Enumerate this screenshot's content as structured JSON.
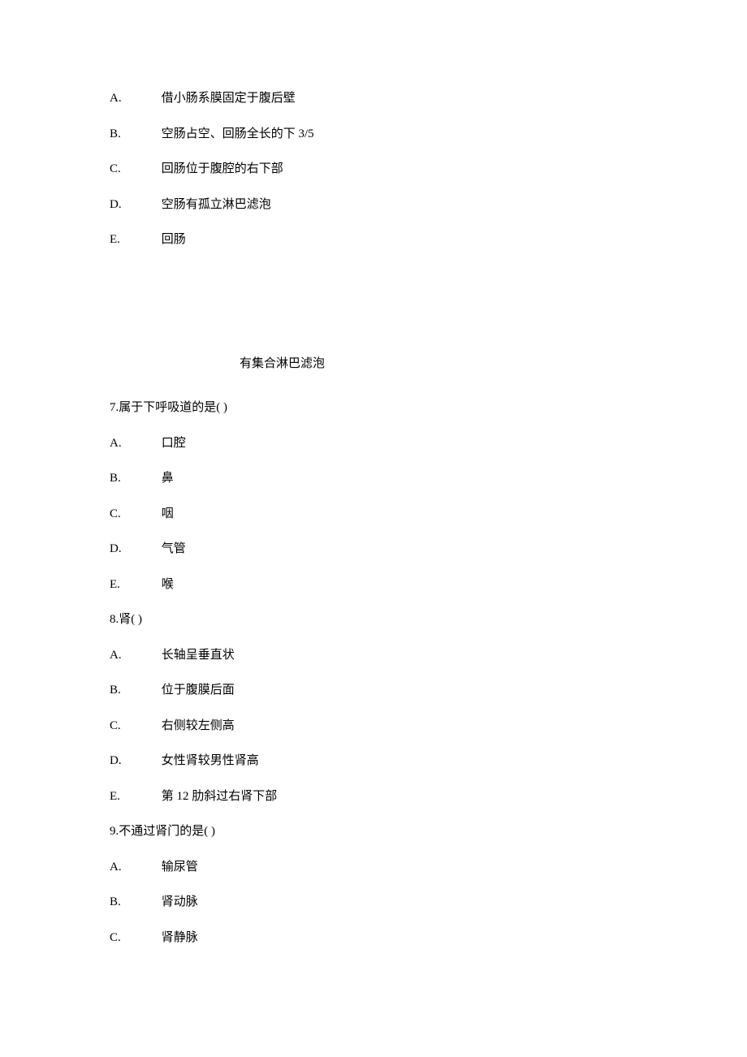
{
  "q6": {
    "A": "借小肠系膜固定于腹后壁",
    "B": "空肠占空、回肠全长的下 3/5",
    "C": "回肠位于腹腔的右下部",
    "D": "空肠有孤立淋巴滤泡",
    "E": " 回肠"
  },
  "fragment": "有集合淋巴滤泡",
  "q7": {
    "stem": "7.属于下呼吸道的是(   )",
    "A": "口腔",
    "B": "鼻",
    "C": "咽",
    "D": "气管",
    "E": " 喉"
  },
  "q8": {
    "stem": "8.肾(  )",
    "A": "长轴呈垂直状",
    "B": "位于腹膜后面",
    "C": "右侧较左侧高",
    "D": "女性肾较男性肾高",
    "E": "  第 12 肋斜过右肾下部"
  },
  "q9": {
    "stem": "9.不通过肾门的是(  )",
    "A": "输尿管",
    "B": "肾动脉",
    "C": "肾静脉"
  },
  "letters": {
    "A": "A.",
    "B": "B.",
    "C": "C.",
    "D": "D.",
    "E": "E."
  }
}
